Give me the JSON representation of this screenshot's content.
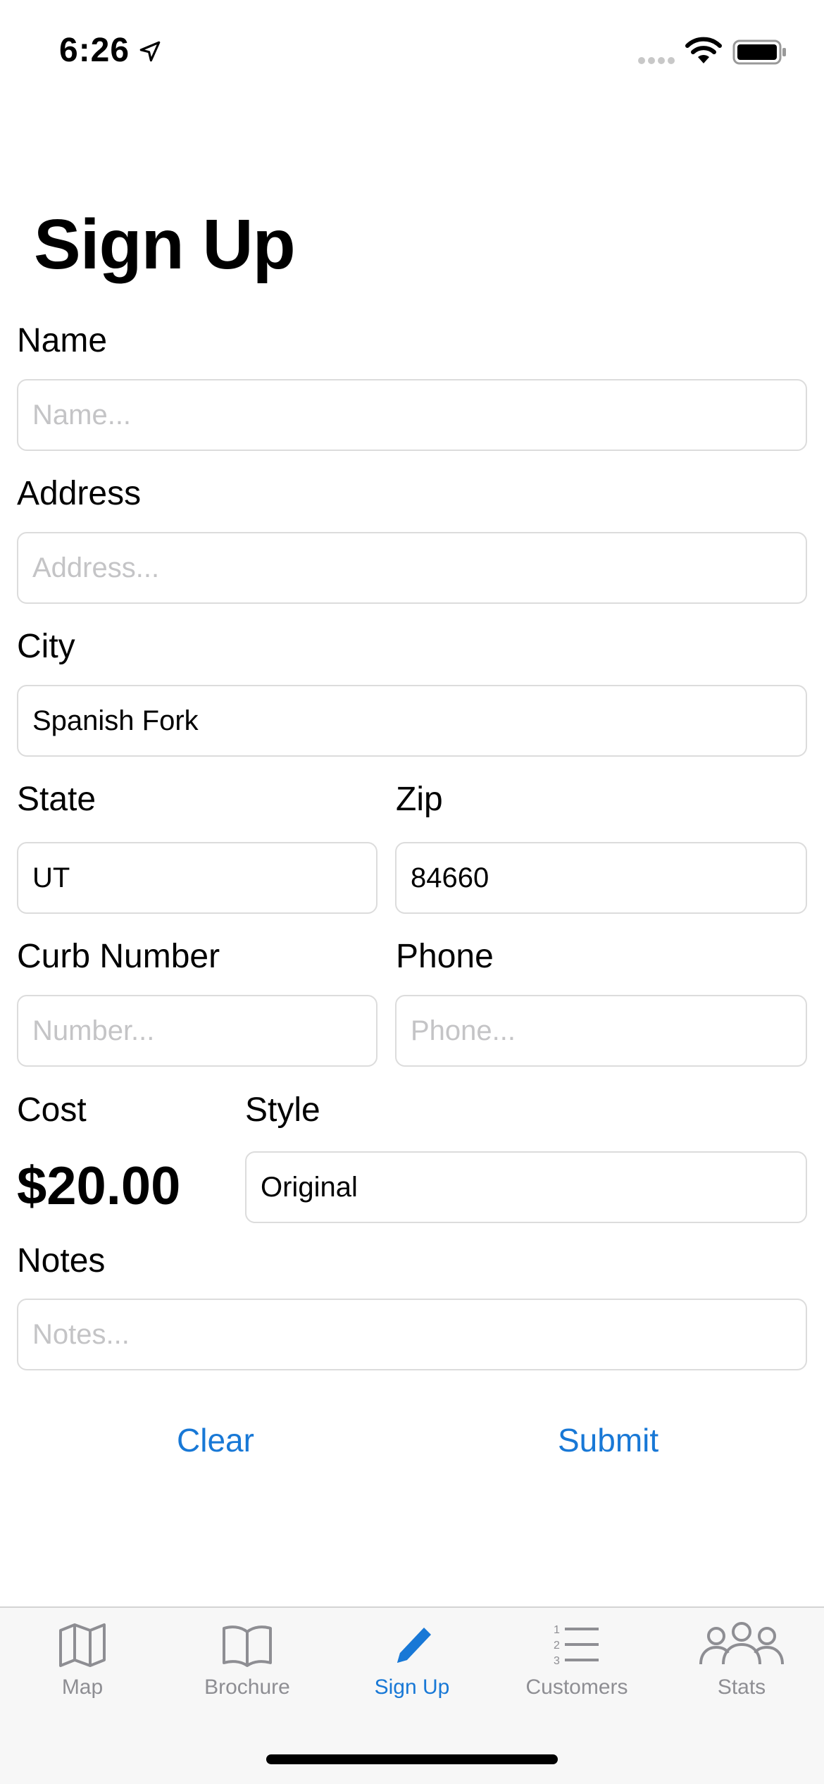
{
  "status_bar": {
    "time": "6:26"
  },
  "page": {
    "title": "Sign Up"
  },
  "form": {
    "name": {
      "label": "Name",
      "placeholder": "Name...",
      "value": ""
    },
    "address": {
      "label": "Address",
      "placeholder": "Address...",
      "value": ""
    },
    "city": {
      "label": "City",
      "placeholder": "",
      "value": "Spanish Fork"
    },
    "state": {
      "label": "State",
      "placeholder": "",
      "value": "UT"
    },
    "zip": {
      "label": "Zip",
      "placeholder": "",
      "value": "84660"
    },
    "curb_number": {
      "label": "Curb Number",
      "placeholder": "Number...",
      "value": ""
    },
    "phone": {
      "label": "Phone",
      "placeholder": "Phone...",
      "value": ""
    },
    "cost": {
      "label": "Cost",
      "value": "$20.00"
    },
    "style": {
      "label": "Style",
      "value": "Original"
    },
    "notes": {
      "label": "Notes",
      "placeholder": "Notes...",
      "value": ""
    }
  },
  "actions": {
    "clear": "Clear",
    "submit": "Submit"
  },
  "tab_bar": {
    "active_color": "#1878d6",
    "inactive_color": "#8e8e93",
    "tabs": [
      {
        "label": "Map",
        "icon": "map-icon"
      },
      {
        "label": "Brochure",
        "icon": "book-icon"
      },
      {
        "label": "Sign Up",
        "icon": "pencil-icon",
        "active": true
      },
      {
        "label": "Customers",
        "icon": "numbered-list-icon"
      },
      {
        "label": "Stats",
        "icon": "people-icon"
      }
    ]
  }
}
